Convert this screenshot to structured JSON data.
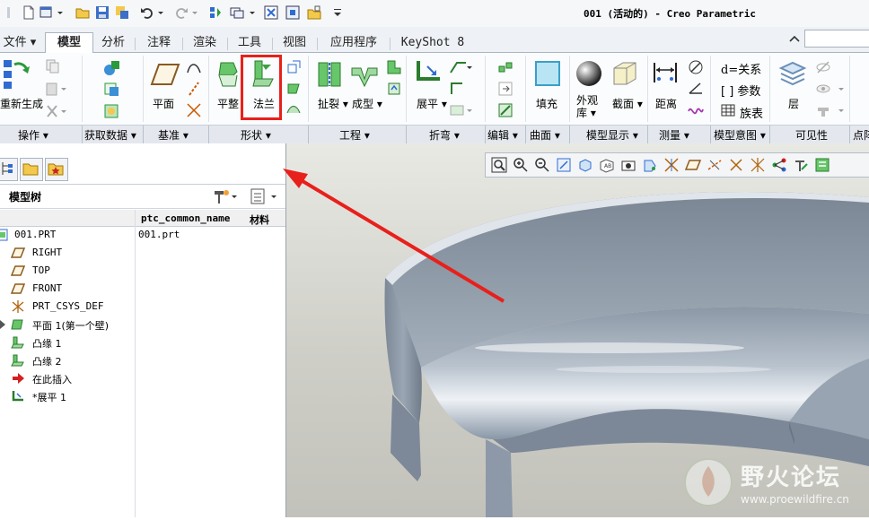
{
  "window": {
    "title": "001 (活动的) - Creo Parametric"
  },
  "tabs": [
    {
      "label": "文件",
      "active": false,
      "dropdown": true
    },
    {
      "label": "模型",
      "active": true
    },
    {
      "label": "分析",
      "active": false
    },
    {
      "label": "注释",
      "active": false
    },
    {
      "label": "渲染",
      "active": false
    },
    {
      "label": "工具",
      "active": false
    },
    {
      "label": "视图",
      "active": false
    },
    {
      "label": "应用程序",
      "active": false
    },
    {
      "label": "KeyShot 8",
      "active": false
    }
  ],
  "ribbon": {
    "buttons": {
      "regenerate": "重新生成",
      "plane": "平面",
      "flat": "平整",
      "flange": "法兰",
      "rip": "扯裂",
      "form": "成型",
      "unbend": "展平",
      "fill": "填充",
      "appearance_line1": "外观",
      "appearance_line2": "库",
      "section": "截面",
      "distance": "距离",
      "relations": "关系",
      "parameters": "参数",
      "family_table": "族表",
      "layer": "层"
    },
    "groups": [
      {
        "label": "操作",
        "dropdown": true
      },
      {
        "label": "获取数据",
        "dropdown": true
      },
      {
        "label": "基准",
        "dropdown": true
      },
      {
        "label": "形状",
        "dropdown": true
      },
      {
        "label": "工程",
        "dropdown": true
      },
      {
        "label": "折弯",
        "dropdown": true
      },
      {
        "label": "编辑",
        "dropdown": true
      },
      {
        "label": "曲面",
        "dropdown": true
      },
      {
        "label": "模型显示",
        "dropdown": true
      },
      {
        "label": "测量",
        "dropdown": true
      },
      {
        "label": "模型意图",
        "dropdown": true
      },
      {
        "label": "可见性",
        "dropdown": false
      },
      {
        "label": "点阵",
        "dropdown": false
      }
    ]
  },
  "model_tree": {
    "title": "模型树",
    "columns": [
      "ptc_common_name",
      "材料"
    ],
    "items": [
      {
        "label": "001.PRT",
        "common_name": "001.prt",
        "icon": "part-icon"
      },
      {
        "label": "RIGHT",
        "icon": "datum-plane-icon"
      },
      {
        "label": "TOP",
        "icon": "datum-plane-icon"
      },
      {
        "label": "FRONT",
        "icon": "datum-plane-icon"
      },
      {
        "label": "PRT_CSYS_DEF",
        "icon": "csys-icon"
      },
      {
        "label": "平面 1(第一个壁)",
        "icon": "flat-wall-icon",
        "expandable": true
      },
      {
        "label": "凸缘 1",
        "icon": "flange-icon"
      },
      {
        "label": "凸缘 2",
        "icon": "flange-icon"
      },
      {
        "label": "在此插入",
        "icon": "insert-here-icon"
      },
      {
        "label": "*展平 1",
        "icon": "unbend-icon"
      }
    ]
  },
  "watermark": {
    "text_cn": "野火论坛",
    "url": "www.proewildfire.cn"
  },
  "colors": {
    "highlight": "#e8201b",
    "ribbon_bg": "#fbfcfd",
    "group_bar": "#e4e8ee"
  }
}
